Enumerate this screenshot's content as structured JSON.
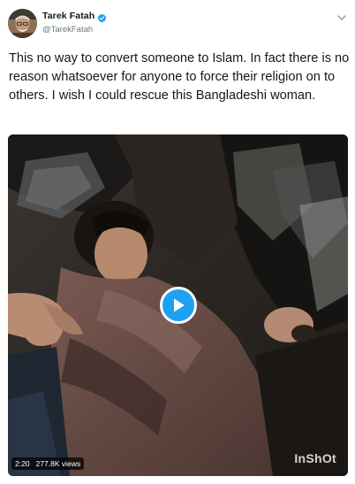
{
  "author": {
    "display_name": "Tarek Fatah",
    "handle": "@TarekFatah",
    "verified_icon": "verified-badge-icon",
    "avatar_icon": "avatar"
  },
  "menu_icon": "chevron-down-icon",
  "tweet": {
    "text": "This no way to convert someone to Islam. In fact there is no reason whatsoever for anyone to force their religion on to others. I wish I could rescue this Bangladeshi woman."
  },
  "video": {
    "duration": "2:20",
    "views": "277.8K views",
    "watermark": "InShOt",
    "play_icon": "play-icon"
  },
  "colors": {
    "accent": "#1da1f2",
    "text": "#14171a",
    "secondary_text": "#657786"
  }
}
